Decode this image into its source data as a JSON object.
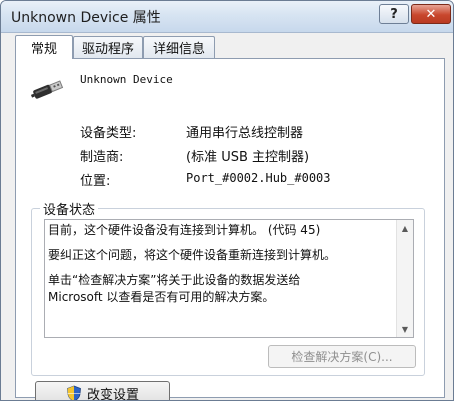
{
  "window": {
    "title": "Unknown Device 属性",
    "help_glyph": "?",
    "close_glyph": "✕"
  },
  "tabs": [
    {
      "label": "常规",
      "active": true
    },
    {
      "label": "驱动程序",
      "active": false
    },
    {
      "label": "详细信息",
      "active": false
    }
  ],
  "device": {
    "name": "Unknown Device",
    "icon": "usb-plug-icon"
  },
  "properties": [
    {
      "label": "设备类型:",
      "value": "通用串行总线控制器"
    },
    {
      "label": "制造商:",
      "value": "(标准 USB 主控制器)"
    },
    {
      "label": "位置:",
      "value": "Port_#0002.Hub_#0003"
    }
  ],
  "status": {
    "group_label": "设备状态",
    "lines": [
      "目前，这个硬件设备没有连接到计算机。 (代码 45)",
      "要纠正这个问题，将这个硬件设备重新连接到计算机。",
      "单击“检查解决方案”将关于此设备的数据发送给\nMicrosoft 以查看是否有可用的解决方案。"
    ],
    "troubleshoot_label": "检查解决方案(C)..."
  },
  "footer": {
    "change_settings_label": "改变设置",
    "change_settings_icon": "uac-shield-icon"
  },
  "colors": {
    "close_button": "#c8472d",
    "shield_blue": "#2b63c6",
    "shield_yellow": "#f3c42f"
  }
}
